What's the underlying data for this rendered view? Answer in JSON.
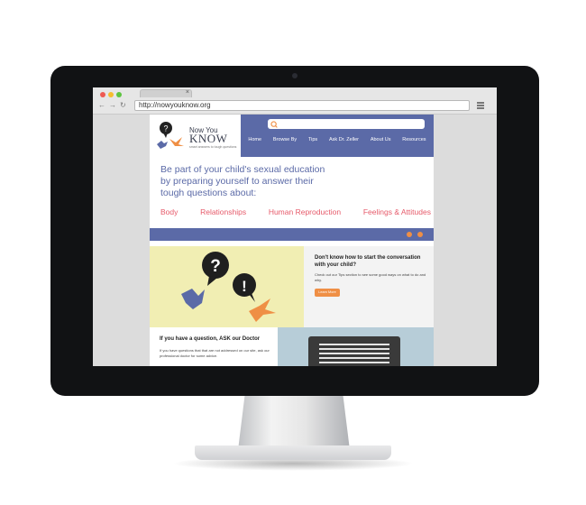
{
  "browser": {
    "tab_close": "×",
    "back": "←",
    "forward": "→",
    "reload": "↻",
    "url": "http://nowyouknow.org"
  },
  "site": {
    "logo": {
      "line1": "Now You",
      "line2": "KNOW",
      "tagline": "smart answers to tough questions"
    },
    "nav": [
      "Home",
      "Browse By",
      "Tips",
      "Ask Dr. Zeller",
      "About Us",
      "Resources"
    ],
    "hero_title": "Be part of your child's sexual education by preparing yourself to answer their tough questions about:",
    "topics": [
      "Body",
      "Relationships",
      "Human Reproduction",
      "Feelings & Attitudes"
    ],
    "promo": {
      "title": "Don't know how to start the conversation with your child?",
      "text": "Check out our Tips section to see some good ways on what to do and why.",
      "button": "Learn More"
    },
    "ask": {
      "title": "If you have a question, ASK our Doctor",
      "text": "If you have questions that that are not addressed on our site, ask our professional doctor for some advice."
    }
  },
  "colors": {
    "brand_blue": "#5b6aa7",
    "accent_orange": "#ef8f45",
    "topic_pink": "#e65a6a",
    "illus_yellow": "#f1eeb3"
  }
}
